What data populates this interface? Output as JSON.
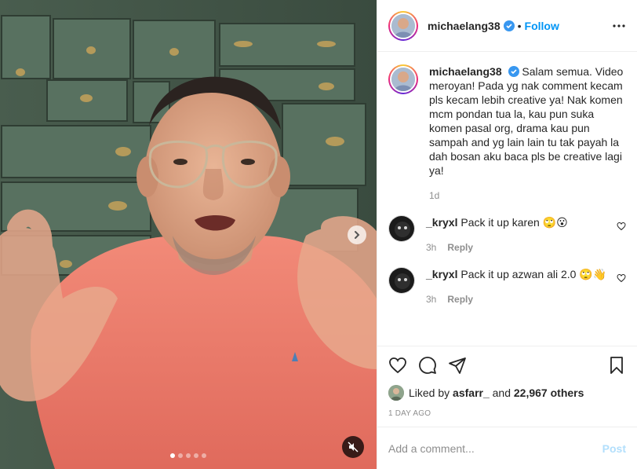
{
  "header": {
    "username": "michaelang38",
    "separator": "•",
    "follow_label": "Follow"
  },
  "caption": {
    "username": "michaelang38",
    "text": "Salam semua. Video meroyan! Pada yg nak comment kecam pls kecam lebih creative ya! Nak komen mcm pondan tua la, kau pun suka komen pasal org, drama kau pun sampah and yg lain lain tu tak payah la dah bosan aku baca pls be creative lagi ya!",
    "time": "1d"
  },
  "comments": [
    {
      "username": "_kryxl",
      "text": "Pack it up karen 🙄😮",
      "time": "3h",
      "reply_label": "Reply"
    },
    {
      "username": "_kryxl",
      "text": "Pack it up azwan ali 2.0 🙄👋",
      "time": "3h",
      "reply_label": "Reply"
    }
  ],
  "likes": {
    "prefix": "Liked by",
    "liker": "asfarr_",
    "conjunction": "and",
    "others": "22,967 others"
  },
  "timestamp": "1 DAY AGO",
  "add_comment": {
    "placeholder": "Add a comment...",
    "post_label": "Post"
  },
  "media": {
    "carousel_total": 5,
    "carousel_active": 1,
    "muted": true
  },
  "colors": {
    "link_blue": "#0095f6",
    "post_disabled": "#b2dffc",
    "shirt": "#f07c6d",
    "cabinet": "#4e6654"
  }
}
